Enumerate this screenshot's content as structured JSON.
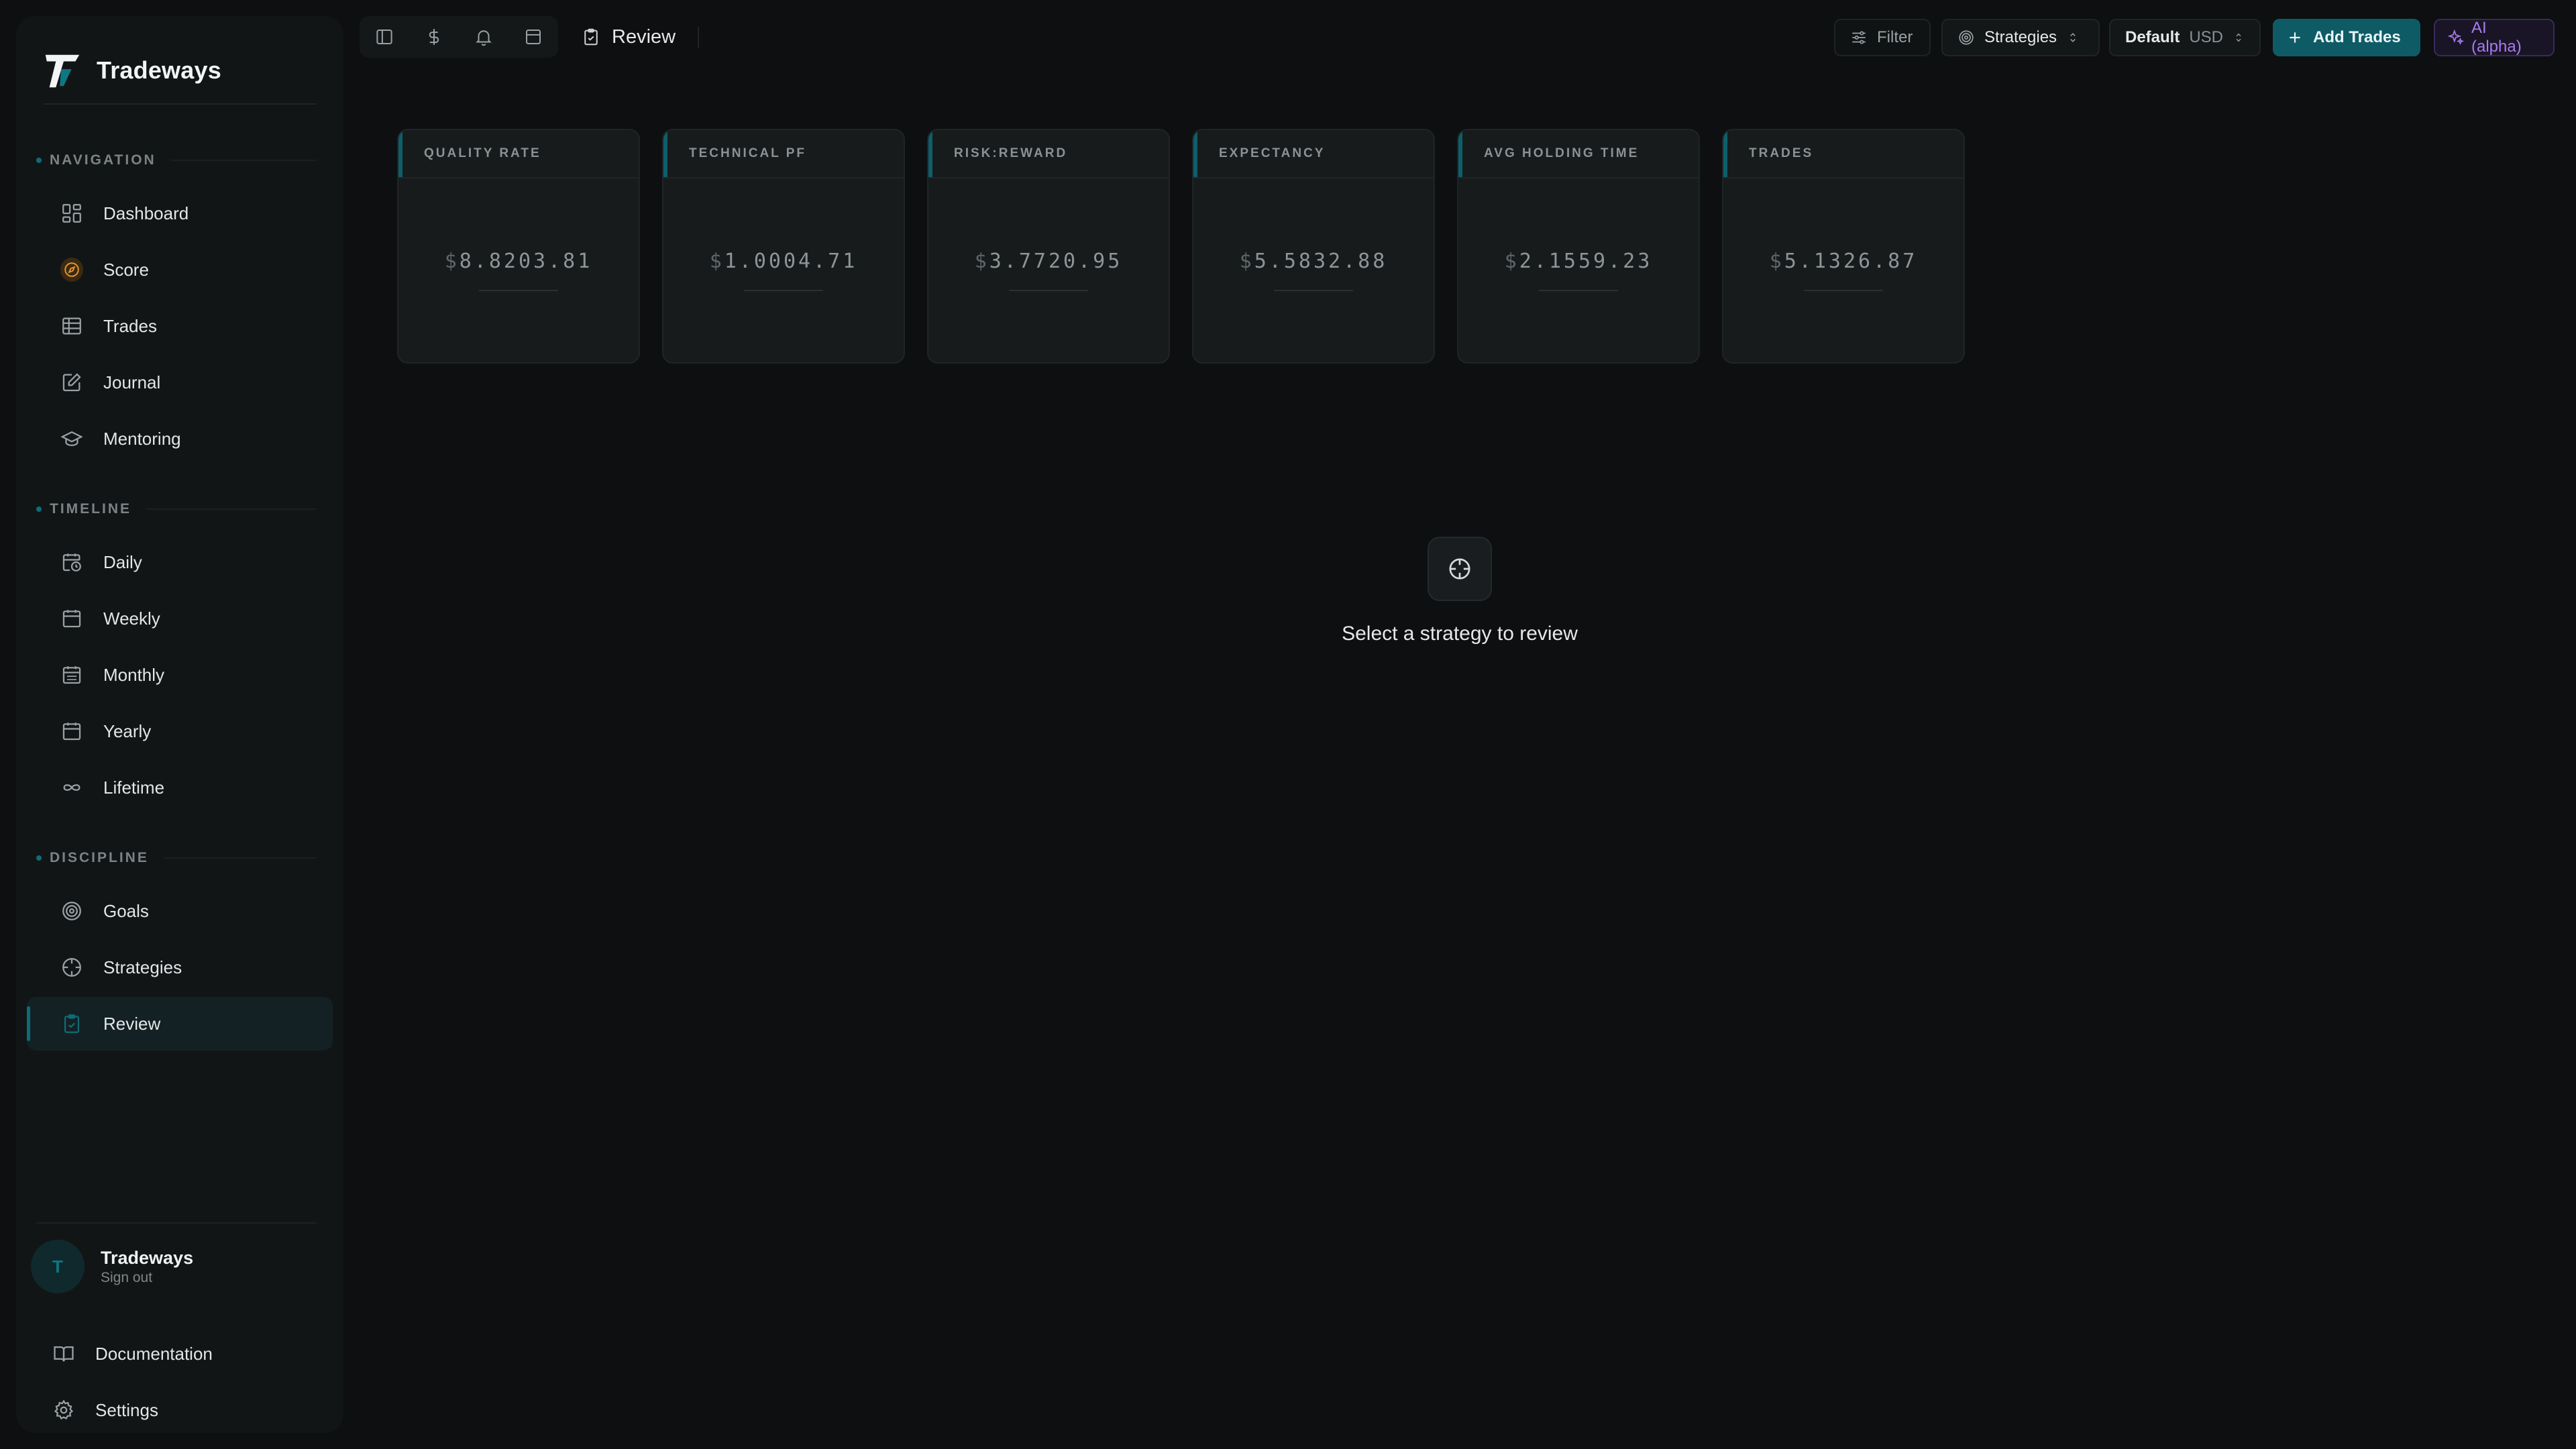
{
  "brand": {
    "name": "Tradeways"
  },
  "sections": {
    "navigation": "NAVIGATION",
    "timeline": "TIMELINE",
    "discipline": "DISCIPLINE"
  },
  "nav": {
    "dashboard": "Dashboard",
    "score": "Score",
    "trades": "Trades",
    "journal": "Journal",
    "mentoring": "Mentoring",
    "daily": "Daily",
    "weekly": "Weekly",
    "monthly": "Monthly",
    "yearly": "Yearly",
    "lifetime": "Lifetime",
    "goals": "Goals",
    "strategies": "Strategies",
    "review": "Review",
    "active": "review"
  },
  "user": {
    "initial": "T",
    "name": "Tradeways",
    "sign_out": "Sign out"
  },
  "footer": {
    "documentation": "Documentation",
    "settings": "Settings"
  },
  "header": {
    "breadcrumb": "Review",
    "filter": "Filter",
    "strategies": "Strategies",
    "default": "Default",
    "currency": "USD",
    "add_trades": "Add Trades",
    "ai": "AI (alpha)"
  },
  "metrics": [
    {
      "label": "QUALITY RATE",
      "currency": "$",
      "value": "8.8203.81"
    },
    {
      "label": "TECHNICAL PF",
      "currency": "$",
      "value": "1.0004.71"
    },
    {
      "label": "RISK:REWARD",
      "currency": "$",
      "value": "3.7720.95"
    },
    {
      "label": "EXPECTANCY",
      "currency": "$",
      "value": "5.5832.88"
    },
    {
      "label": "AVG HOLDING TIME",
      "currency": "$",
      "value": "2.1559.23"
    },
    {
      "label": "TRADES",
      "currency": "$",
      "value": "5.1326.87"
    }
  ],
  "empty_state": {
    "message": "Select a strategy to review"
  },
  "colors": {
    "accent": "#0e5b66",
    "accent_bright": "#0f7782",
    "ai_purple": "#a67cf0",
    "score_orange": "#e8952a",
    "background": "#0d0f10"
  }
}
